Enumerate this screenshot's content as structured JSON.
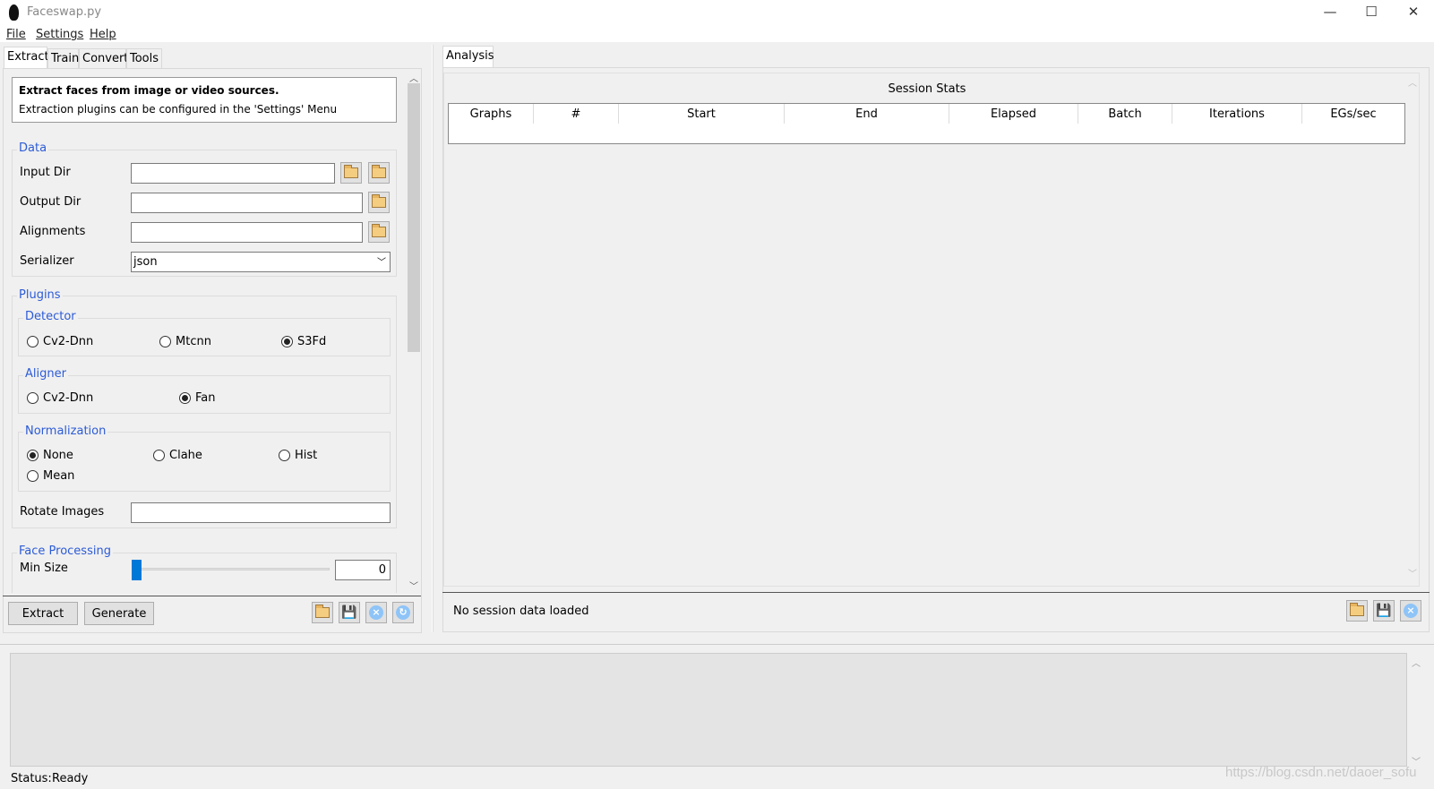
{
  "window": {
    "title": "Faceswap.py",
    "minimize": "—",
    "maximize": "☐",
    "close": "✕"
  },
  "menu": [
    "File",
    "Settings",
    "Help"
  ],
  "left_tabs": [
    "Extract",
    "Train",
    "Convert",
    "Tools"
  ],
  "info": {
    "title": "Extract faces from image or video sources.",
    "subtitle": "Extraction plugins can be configured in the 'Settings' Menu"
  },
  "data_group": {
    "label": "Data",
    "input_dir": "Input Dir",
    "output_dir": "Output Dir",
    "alignments": "Alignments",
    "serializer": "Serializer",
    "serializer_value": "json"
  },
  "plugins": {
    "label": "Plugins",
    "detector": {
      "label": "Detector",
      "options": [
        "Cv2-Dnn",
        "Mtcnn",
        "S3Fd"
      ],
      "selected": "S3Fd"
    },
    "aligner": {
      "label": "Aligner",
      "options": [
        "Cv2-Dnn",
        "Fan"
      ],
      "selected": "Fan"
    },
    "normalization": {
      "label": "Normalization",
      "options": [
        "None",
        "Clahe",
        "Hist",
        "Mean"
      ],
      "selected": "None"
    },
    "rotate_images": "Rotate Images"
  },
  "face_processing": {
    "label": "Face Processing",
    "min_size": "Min Size",
    "min_size_value": "0"
  },
  "buttons": {
    "extract": "Extract",
    "generate": "Generate"
  },
  "right_tabs": [
    "Analysis"
  ],
  "session_stats": {
    "title": "Session Stats",
    "columns": [
      "Graphs",
      "#",
      "Start",
      "End",
      "Elapsed",
      "Batch",
      "Iterations",
      "EGs/sec"
    ]
  },
  "analysis_status": "No session data loaded",
  "status": {
    "label": "Status:",
    "value": "Ready"
  },
  "watermark": "https://blog.csdn.net/daoer_sofu",
  "colors": {
    "group_label": "#2c5bd6",
    "slider": "#0078d7"
  }
}
